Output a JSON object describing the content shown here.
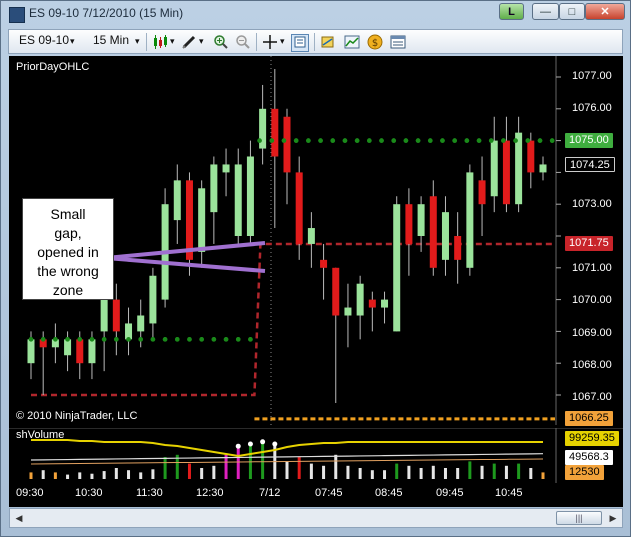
{
  "window": {
    "title": "ES 09-10  7/12/2010 (15 Min)",
    "buttons": {
      "mode": "L",
      "minimize": "—",
      "maximize": "□",
      "close": "✕"
    }
  },
  "toolbar": {
    "instrument": "ES 09-10",
    "interval": "15 Min",
    "dropdown_arrow": "▾",
    "icons": [
      "candlestick-icon",
      "pencil-icon",
      "zoom-in-icon",
      "zoom-out-icon",
      "crosshair-icon",
      "properties-icon",
      "strategy-icon",
      "chart-style-icon",
      "dollar-icon",
      "data-box-icon"
    ]
  },
  "chart": {
    "indicator_label": "PriorDayOHLC",
    "copyright": "© 2010 NinjaTrader, LLC",
    "volume_label": "shVolume",
    "callout_lines": [
      "Small",
      "gap,",
      "opened in",
      "the wrong",
      "zone"
    ],
    "price_axis": [
      "1077.00",
      "1076.00",
      "1074.25",
      "1073.00",
      "1072.00",
      "1071.00",
      "1070.00",
      "1069.00",
      "1068.00",
      "1067.00"
    ],
    "price_axis_hidden_note": "",
    "tags": {
      "high": "1075.00",
      "last": "1074.25",
      "close": "1071.75",
      "low": "1066.25"
    },
    "volume_tags": {
      "top": "99259.35",
      "mid": "49568.3",
      "last": "12530"
    },
    "time_axis": [
      "09:30",
      "10:30",
      "11:30",
      "12:30",
      "7/12",
      "07:45",
      "08:45",
      "09:45",
      "10:45"
    ],
    "colors": {
      "up": "#9be39b",
      "down": "#e21b1b",
      "green_dots": "#1a8a1a",
      "red_dash": "#b0262c",
      "orange_dash": "#f0a020",
      "purple": "#a070d0",
      "yellow_line": "#e6d200",
      "tag_green": "#3fae3f",
      "tag_red": "#c8242a",
      "tag_orange": "#f2a23a"
    }
  },
  "chart_data": {
    "type": "bar",
    "title": "",
    "ylim": [
      1066.0,
      1077.5
    ],
    "price_ticks": [
      1077,
      1076,
      1075,
      1074,
      1073,
      1072,
      1071,
      1070,
      1069,
      1068,
      1067
    ],
    "candles": [
      {
        "o": 1068.0,
        "c": 1068.75,
        "h": 1069.0,
        "l": 1067.5
      },
      {
        "o": 1068.75,
        "c": 1068.5,
        "h": 1069.0,
        "l": 1067.0
      },
      {
        "o": 1068.5,
        "c": 1068.75,
        "h": 1069.25,
        "l": 1068.0
      },
      {
        "o": 1068.25,
        "c": 1068.75,
        "h": 1069.0,
        "l": 1067.75
      },
      {
        "o": 1068.75,
        "c": 1068.0,
        "h": 1069.0,
        "l": 1067.5
      },
      {
        "o": 1068.0,
        "c": 1068.75,
        "h": 1069.0,
        "l": 1067.5
      },
      {
        "o": 1069.0,
        "c": 1070.0,
        "h": 1070.25,
        "l": 1067.75
      },
      {
        "o": 1070.0,
        "c": 1069.0,
        "h": 1070.5,
        "l": 1068.25
      },
      {
        "o": 1068.75,
        "c": 1069.25,
        "h": 1069.75,
        "l": 1068.25
      },
      {
        "o": 1069.0,
        "c": 1069.5,
        "h": 1070.0,
        "l": 1068.5
      },
      {
        "o": 1069.25,
        "c": 1070.75,
        "h": 1071.0,
        "l": 1068.75
      },
      {
        "o": 1070.0,
        "c": 1073.0,
        "h": 1073.5,
        "l": 1069.75
      },
      {
        "o": 1072.5,
        "c": 1073.75,
        "h": 1074.25,
        "l": 1071.75
      },
      {
        "o": 1073.75,
        "c": 1071.25,
        "h": 1074.0,
        "l": 1070.75
      },
      {
        "o": 1071.5,
        "c": 1073.5,
        "h": 1073.75,
        "l": 1071.0
      },
      {
        "o": 1072.75,
        "c": 1074.25,
        "h": 1074.5,
        "l": 1071.75
      },
      {
        "o": 1074.0,
        "c": 1074.25,
        "h": 1074.75,
        "l": 1073.25
      },
      {
        "o": 1072.0,
        "c": 1074.25,
        "h": 1074.75,
        "l": 1071.75
      },
      {
        "o": 1072.0,
        "c": 1074.5,
        "h": 1075.0,
        "l": 1071.75
      },
      {
        "o": 1074.75,
        "c": 1076.0,
        "h": 1076.75,
        "l": 1074.25
      },
      {
        "o": 1076.0,
        "c": 1074.5,
        "h": 1077.25,
        "l": 1072.25
      },
      {
        "o": 1075.75,
        "c": 1074.0,
        "h": 1076.0,
        "l": 1073.0
      },
      {
        "o": 1074.0,
        "c": 1071.75,
        "h": 1074.5,
        "l": 1071.25
      },
      {
        "o": 1071.75,
        "c": 1072.25,
        "h": 1072.75,
        "l": 1071.0
      },
      {
        "o": 1071.25,
        "c": 1071.0,
        "h": 1071.75,
        "l": 1070.0
      },
      {
        "o": 1071.0,
        "c": 1069.5,
        "h": 1071.0,
        "l": 1066.75
      },
      {
        "o": 1069.5,
        "c": 1069.75,
        "h": 1070.5,
        "l": 1068.5
      },
      {
        "o": 1069.5,
        "c": 1070.5,
        "h": 1070.75,
        "l": 1068.75
      },
      {
        "o": 1070.0,
        "c": 1069.75,
        "h": 1070.25,
        "l": 1069.0
      },
      {
        "o": 1069.75,
        "c": 1070.0,
        "h": 1070.25,
        "l": 1069.25
      },
      {
        "o": 1069.0,
        "c": 1073.0,
        "h": 1073.25,
        "l": 1069.0
      },
      {
        "o": 1073.0,
        "c": 1071.75,
        "h": 1073.5,
        "l": 1070.75
      },
      {
        "o": 1072.0,
        "c": 1073.0,
        "h": 1073.25,
        "l": 1071.5
      },
      {
        "o": 1073.25,
        "c": 1071.0,
        "h": 1073.75,
        "l": 1070.75
      },
      {
        "o": 1071.25,
        "c": 1072.75,
        "h": 1073.25,
        "l": 1070.75
      },
      {
        "o": 1072.0,
        "c": 1071.25,
        "h": 1072.75,
        "l": 1070.5
      },
      {
        "o": 1071.0,
        "c": 1074.0,
        "h": 1074.25,
        "l": 1070.75
      },
      {
        "o": 1073.75,
        "c": 1073.0,
        "h": 1074.5,
        "l": 1072.0
      },
      {
        "o": 1073.25,
        "c": 1075.0,
        "h": 1075.75,
        "l": 1072.75
      },
      {
        "o": 1075.0,
        "c": 1073.0,
        "h": 1075.75,
        "l": 1072.75
      },
      {
        "o": 1073.0,
        "c": 1075.25,
        "h": 1075.75,
        "l": 1072.75
      },
      {
        "o": 1075.0,
        "c": 1074.0,
        "h": 1075.25,
        "l": 1073.5
      },
      {
        "o": 1074.0,
        "c": 1074.25,
        "h": 1074.5,
        "l": 1073.75
      }
    ],
    "prior_high": 1075.0,
    "prior_close": 1071.75,
    "prior_low": 1066.25,
    "volume": [
      {
        "v": 0.15,
        "c": "orange"
      },
      {
        "v": 0.2,
        "c": "white"
      },
      {
        "v": 0.15,
        "c": "orange"
      },
      {
        "v": 0.1,
        "c": "white"
      },
      {
        "v": 0.15,
        "c": "white"
      },
      {
        "v": 0.12,
        "c": "white"
      },
      {
        "v": 0.18,
        "c": "white"
      },
      {
        "v": 0.25,
        "c": "white"
      },
      {
        "v": 0.2,
        "c": "white"
      },
      {
        "v": 0.15,
        "c": "white"
      },
      {
        "v": 0.22,
        "c": "white"
      },
      {
        "v": 0.5,
        "c": "green"
      },
      {
        "v": 0.55,
        "c": "green"
      },
      {
        "v": 0.35,
        "c": "red"
      },
      {
        "v": 0.25,
        "c": "white"
      },
      {
        "v": 0.3,
        "c": "white"
      },
      {
        "v": 0.55,
        "c": "magenta"
      },
      {
        "v": 0.7,
        "c": "magenta"
      },
      {
        "v": 0.75,
        "c": "green"
      },
      {
        "v": 0.8,
        "c": "green"
      },
      {
        "v": 0.75,
        "c": "white"
      },
      {
        "v": 0.4,
        "c": "white"
      },
      {
        "v": 0.5,
        "c": "red"
      },
      {
        "v": 0.35,
        "c": "white"
      },
      {
        "v": 0.3,
        "c": "white"
      },
      {
        "v": 0.55,
        "c": "white"
      },
      {
        "v": 0.3,
        "c": "white"
      },
      {
        "v": 0.25,
        "c": "white"
      },
      {
        "v": 0.2,
        "c": "white"
      },
      {
        "v": 0.2,
        "c": "white"
      },
      {
        "v": 0.35,
        "c": "green"
      },
      {
        "v": 0.3,
        "c": "white"
      },
      {
        "v": 0.25,
        "c": "white"
      },
      {
        "v": 0.3,
        "c": "white"
      },
      {
        "v": 0.25,
        "c": "white"
      },
      {
        "v": 0.25,
        "c": "white"
      },
      {
        "v": 0.4,
        "c": "green"
      },
      {
        "v": 0.3,
        "c": "white"
      },
      {
        "v": 0.35,
        "c": "green"
      },
      {
        "v": 0.3,
        "c": "white"
      },
      {
        "v": 0.35,
        "c": "green"
      },
      {
        "v": 0.25,
        "c": "white"
      },
      {
        "v": 0.15,
        "c": "orange"
      }
    ]
  }
}
